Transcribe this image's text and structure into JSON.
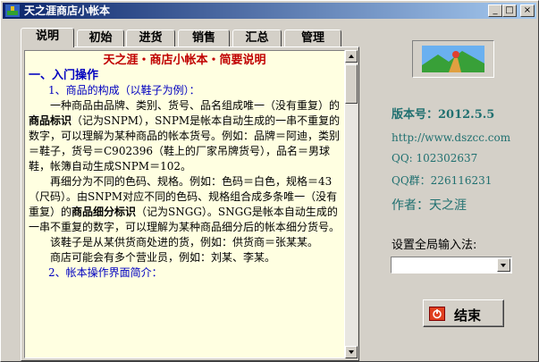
{
  "window": {
    "title": "天之涯商店小帐本",
    "controls": {
      "minimize": "_",
      "maximize": "□",
      "close": "×"
    }
  },
  "tabs": [
    {
      "label": "说明",
      "active": true
    },
    {
      "label": "初始",
      "active": false
    },
    {
      "label": "进货",
      "active": false
    },
    {
      "label": "销售",
      "active": false
    },
    {
      "label": "汇总",
      "active": false
    },
    {
      "label": "管理",
      "active": false
    }
  ],
  "doc": {
    "title": "天之涯・商店小帐本・简要说明",
    "section1": "一、入门操作",
    "sub1": "1、商品的构成（以鞋子为例）：",
    "p1a": "一种商品由品牌、类别、货号、品名组成唯一（没有重复）的",
    "p1b": "商品标识",
    "p1c": "（记为SNPM），SNPM是帐本自动生成的一串不重复的数字，可以理解为某种商品的帐本货号。例如：品牌＝阿迪，类别＝鞋子，货号＝C902396（鞋上的厂家吊牌货号），品名＝男球鞋，帐簿自动生成SNPM＝102。",
    "p2a": "再细分为不同的色码、规格。例如：色码＝白色，规格＝43（尺码）。由SNPM对应不同的色码、规格组合成多条唯一（没有重复）的",
    "p2b": "商品细分标识",
    "p2c": "（记为SNGG）。SNGG是帐本自动生成的一串不重复的数字，可以理解为某种商品细分后的帐本细分货号。",
    "p3": "该鞋子是从某供货商处进的货，例如：供货商＝张某某。",
    "p4": "商店可能会有多个营业员，例如：刘某、李某。",
    "sub2": "2、帐本操作界面简介："
  },
  "info": {
    "version": "版本号：2012.5.5",
    "url": "http://www.dszcc.com",
    "qq": "QQ: 102302637",
    "qq_group": "QQ群：226116231",
    "author": "作者：天之涯"
  },
  "input_method": {
    "label": "设置全局输入法:",
    "value": ""
  },
  "exit_button": {
    "label": "结束"
  },
  "colors": {
    "accent_red": "#c00000",
    "heading_blue": "#0000c0",
    "info_teal": "#207070",
    "doc_bg": "#ffffe1"
  }
}
